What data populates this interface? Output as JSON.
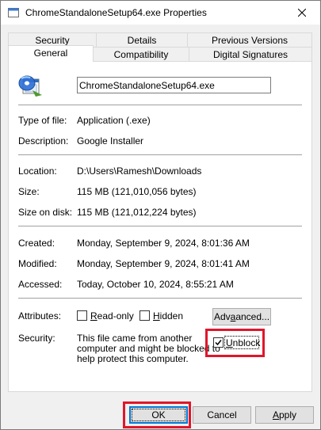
{
  "window": {
    "title": "ChromeStandaloneSetup64.exe Properties"
  },
  "tabs": {
    "row1": [
      "Security",
      "Details",
      "Previous Versions"
    ],
    "row2": [
      "General",
      "Compatibility",
      "Digital Signatures"
    ],
    "active": "General"
  },
  "general": {
    "filename": "ChromeStandaloneSetup64.exe",
    "type_label": "Type of file:",
    "type_value": "Application (.exe)",
    "description_label": "Description:",
    "description_value": "Google Installer",
    "location_label": "Location:",
    "location_value": "D:\\Users\\Ramesh\\Downloads",
    "size_label": "Size:",
    "size_value": "115 MB (121,010,056 bytes)",
    "size_on_disk_label": "Size on disk:",
    "size_on_disk_value": "115 MB (121,012,224 bytes)",
    "created_label": "Created:",
    "created_value": "Monday, September 9, 2024, 8:01:36 AM",
    "modified_label": "Modified:",
    "modified_value": "Monday, September 9, 2024, 8:01:41 AM",
    "accessed_label": "Accessed:",
    "accessed_value": "Today, October 10, 2024, 8:55:21 AM",
    "attributes_label": "Attributes:",
    "readonly_rest": "ead-only",
    "hidden_rest": "idden",
    "advanced_rest": "anced...",
    "security_label": "Security:",
    "security_line1": "This file came from another",
    "security_line2": "computer and might be blocked to",
    "security_line3": "help protect this computer.",
    "unblock_rest": "nblock"
  },
  "buttons": {
    "ok": "OK",
    "cancel": "Cancel",
    "apply_rest": "pply"
  },
  "state": {
    "readonly_checked": false,
    "hidden_checked": false,
    "unblock_checked": true
  },
  "colors": {
    "highlight": "#e0162b",
    "ok_border": "#0078d7"
  }
}
